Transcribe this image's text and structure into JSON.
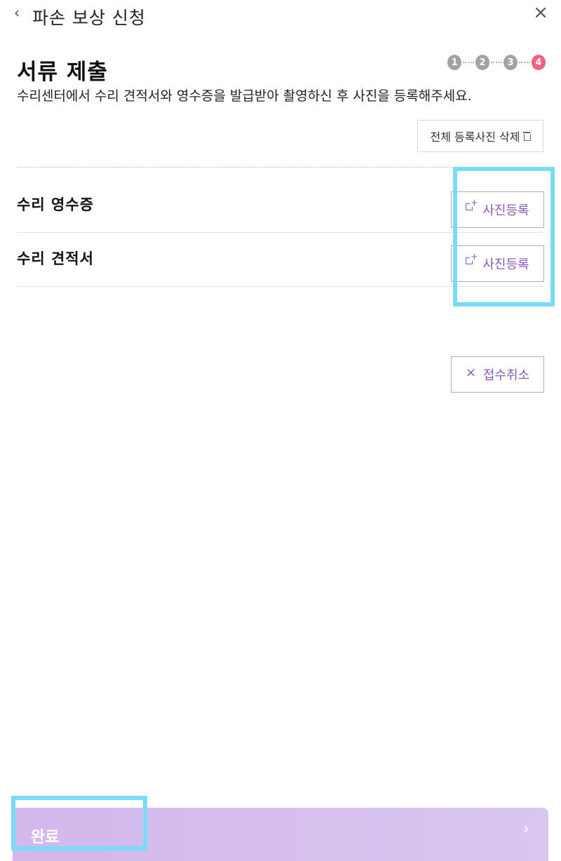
{
  "header": {
    "back_icon": "chevron-left-icon",
    "title": "파손 보상 신청",
    "close_icon": "close-icon"
  },
  "page_title": "서류 제출",
  "stepper": {
    "steps": [
      "1",
      "2",
      "3",
      "4"
    ],
    "current": 4,
    "active_color": "#f0607f",
    "inactive_color": "#a3a3a3"
  },
  "instruction": "수리센터에서 수리 견적서와 영수증을 발급받아 촬영하신 후 사진을 등록해주세요.",
  "delete_all_label": "전체 등록사진 삭제",
  "documents": [
    {
      "label": "수리 영수증",
      "button_label": "사진등록"
    },
    {
      "label": "수리 견적서",
      "button_label": "사진등록"
    }
  ],
  "cancel_label": "접수취소",
  "complete_label": "완료",
  "accent_color": "#8a58b8",
  "highlight_color": "#77dcf7"
}
